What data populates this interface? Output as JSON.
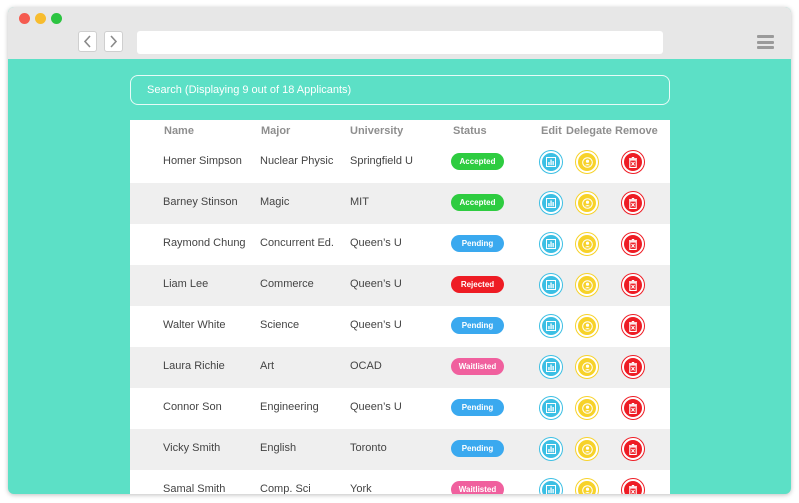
{
  "browser": {
    "address_value": ""
  },
  "search": {
    "text": "Search (Displaying 9 out of 18 Applicants)"
  },
  "table": {
    "headers": {
      "name": "Name",
      "major": "Major",
      "university": "University",
      "status": "Status",
      "edit": "Edit",
      "delegate": "Delegate",
      "remove": "Remove"
    },
    "rows": [
      {
        "name": "Homer Simpson",
        "major": "Nuclear Physic",
        "university": "Springfield U",
        "status": "Accepted"
      },
      {
        "name": "Barney Stinson",
        "major": "Magic",
        "university": "MIT",
        "status": "Accepted"
      },
      {
        "name": "Raymond Chung",
        "major": "Concurrent Ed.",
        "university": "Queen’s U",
        "status": "Pending"
      },
      {
        "name": "Liam Lee",
        "major": "Commerce",
        "university": "Queen’s U",
        "status": "Rejected"
      },
      {
        "name": "Walter White",
        "major": "Science",
        "university": "Queen’s U",
        "status": "Pending"
      },
      {
        "name": "Laura Richie",
        "major": "Art",
        "university": "OCAD",
        "status": "Waitlisted"
      },
      {
        "name": "Connor Son",
        "major": "Engineering",
        "university": "Queen’s U",
        "status": "Pending"
      },
      {
        "name": "Vicky Smith",
        "major": "English",
        "university": "Toronto",
        "status": "Pending"
      },
      {
        "name": "Samal Smith",
        "major": "Comp. Sci",
        "university": "York",
        "status": "Waitlisted"
      }
    ]
  },
  "status_colors": {
    "Accepted": "#2ecc40",
    "Pending": "#3aa9ef",
    "Rejected": "#ee1c24",
    "Waitlisted": "#f0609e"
  },
  "icons": {
    "edit": "bar-chart-icon",
    "delegate": "user-icon",
    "remove": "trash-icon"
  }
}
